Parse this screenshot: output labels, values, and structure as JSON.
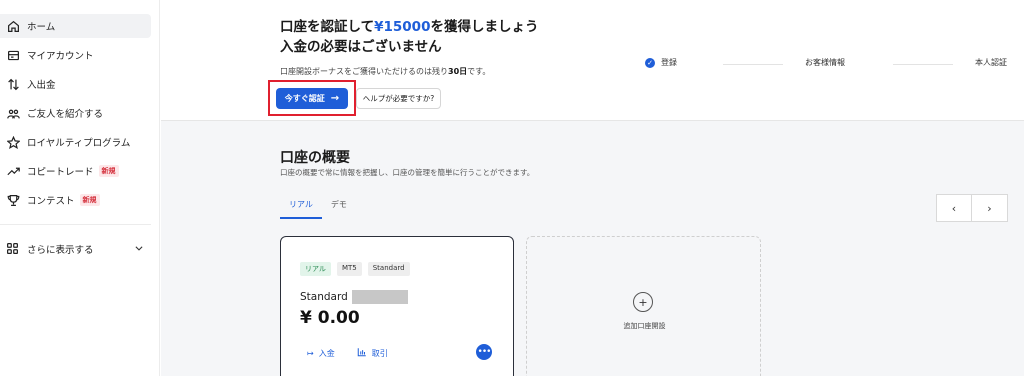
{
  "sidebar": {
    "items": [
      {
        "label": "ホーム",
        "icon": "home-icon"
      },
      {
        "label": "マイアカウント",
        "icon": "wallet-icon"
      },
      {
        "label": "入出金",
        "icon": "transfer-icon"
      },
      {
        "label": "ご友人を紹介する",
        "icon": "users-icon"
      },
      {
        "label": "ロイヤルティプログラム",
        "icon": "star-icon"
      },
      {
        "label": "コピートレード",
        "icon": "trend-icon",
        "badge": "新規"
      },
      {
        "label": "コンテスト",
        "icon": "trophy-icon",
        "badge": "新規"
      }
    ],
    "more_label": "さらに表示する"
  },
  "banner": {
    "headline_prefix": "口座を認証して",
    "headline_amount": "¥15000",
    "headline_suffix": "を獲得しましょう",
    "headline_line2": "入金の必要はございません",
    "note_prefix": "口座開設ボーナスをご獲得いただけるのは残り",
    "note_days": "30日",
    "note_suffix": "です。",
    "verify_button": "今すぐ認証",
    "help_button": "ヘルプが必要ですか?",
    "steps": [
      "登録",
      "お客様情報",
      "本人認証"
    ]
  },
  "overview": {
    "title": "口座の概要",
    "subtitle": "口座の概要で常に情報を把握し、口座の管理を簡単に行うことができます。",
    "tabs": [
      "リアル",
      "デモ"
    ],
    "pager_prev": "‹",
    "pager_next": "›",
    "card": {
      "tags": [
        "リアル",
        "MT5",
        "Standard"
      ],
      "name": "Standard",
      "balance": "¥ 0.00",
      "deposit": "入金",
      "withdraw": "取引",
      "more": "•••"
    },
    "add_card_label": "追加口座開設"
  },
  "colors": {
    "accent": "#1f5ed8",
    "highlight": "#e0202f",
    "badge": "#d4303c"
  }
}
